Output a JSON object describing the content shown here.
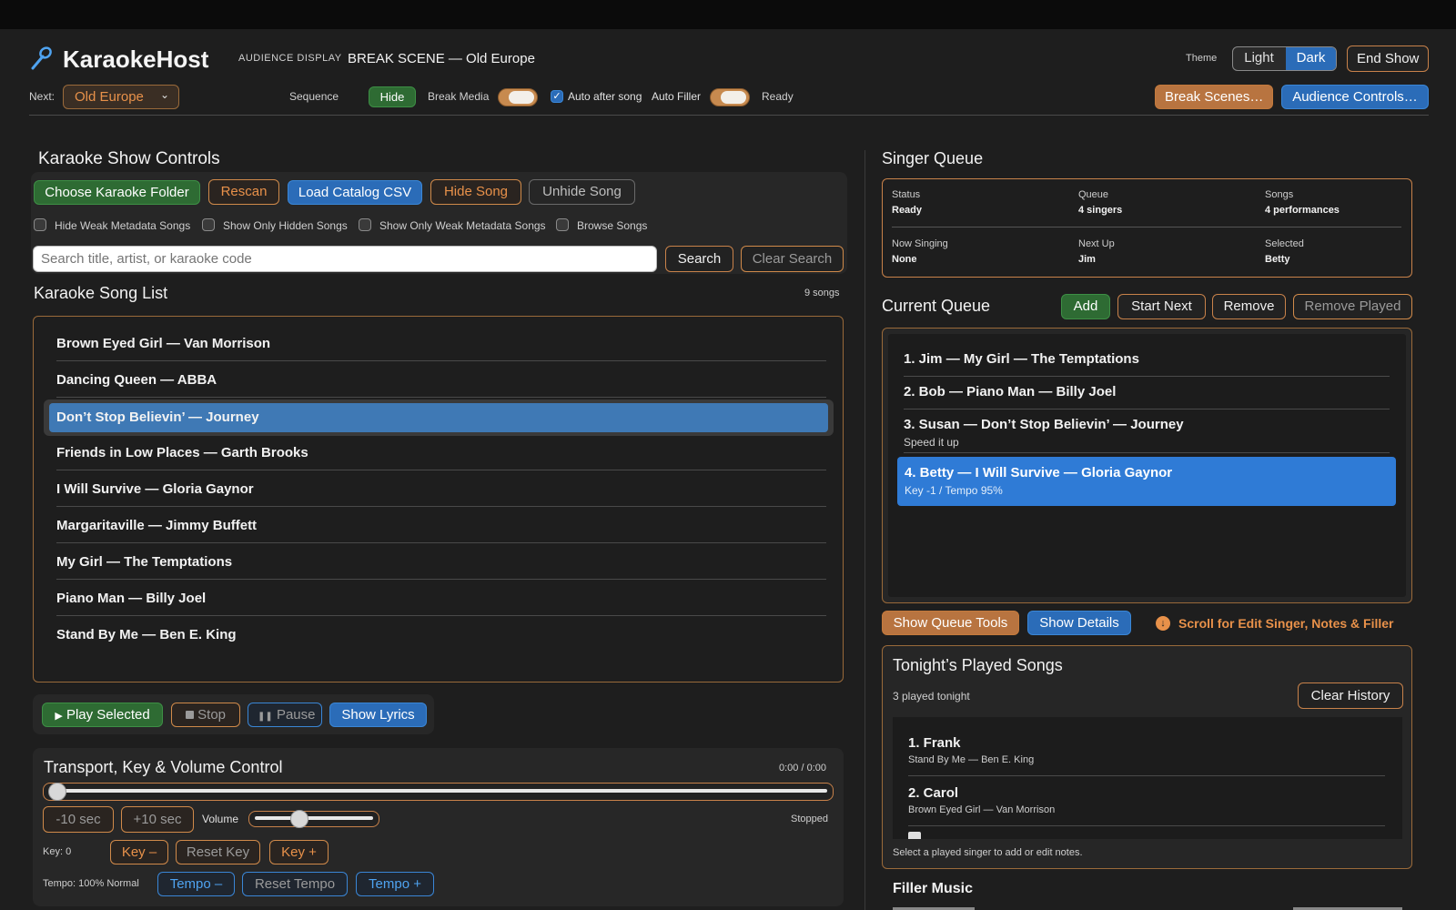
{
  "header": {
    "app_title": "KaraokeHost",
    "audience_display_label": "AUDIENCE DISPLAY",
    "audience_display_value": "BREAK SCENE — Old Europe",
    "theme_label": "Theme",
    "theme_light": "Light",
    "theme_dark": "Dark",
    "end_show": "End Show",
    "next_label": "Next:",
    "next_value": "Old Europe",
    "sequence_label": "Sequence",
    "hide_button": "Hide",
    "break_media_label": "Break Media",
    "auto_after_song_label": "Auto after song",
    "auto_after_song_checked": true,
    "auto_filler_label": "Auto Filler",
    "ready_label": "Ready",
    "break_scenes_button": "Break Scenes…",
    "audience_controls_button": "Audience Controls…"
  },
  "show_controls": {
    "title": "Karaoke Show Controls",
    "choose_folder": "Choose Karaoke Folder",
    "rescan": "Rescan",
    "load_catalog": "Load Catalog CSV",
    "hide_song": "Hide Song",
    "unhide_song": "Unhide Song",
    "filters": [
      "Hide Weak Metadata Songs",
      "Show Only Hidden Songs",
      "Show Only Weak Metadata Songs",
      "Browse Songs"
    ],
    "search_placeholder": "Search title, artist, or karaoke code",
    "search_button": "Search",
    "clear_search_button": "Clear Search"
  },
  "song_list": {
    "title": "Karaoke Song List",
    "count": "9 songs",
    "songs": [
      "Brown Eyed Girl — Van Morrison",
      "Dancing Queen — ABBA",
      "Don’t Stop Believin’ — Journey",
      "Friends in Low Places — Garth Brooks",
      "I Will Survive — Gloria Gaynor",
      "Margaritaville — Jimmy Buffett",
      "My Girl — The Temptations",
      "Piano Man — Billy Joel",
      "Stand By Me — Ben E. King"
    ],
    "selected_index": 2
  },
  "playback": {
    "play_selected": "Play Selected",
    "stop": "Stop",
    "pause": "Pause",
    "show_lyrics": "Show Lyrics"
  },
  "transport": {
    "title": "Transport, Key & Volume Control",
    "time": "0:00 / 0:00",
    "back_10": "-10 sec",
    "fwd_10": "+10 sec",
    "volume_label": "Volume",
    "status": "Stopped",
    "key_label": "Key: 0",
    "key_minus": "Key –",
    "reset_key": "Reset Key",
    "key_plus": "Key +",
    "tempo_label": "Tempo: 100% Normal",
    "tempo_minus": "Tempo –",
    "reset_tempo": "Reset Tempo",
    "tempo_plus": "Tempo +",
    "position_fraction": 0.0,
    "volume_fraction": 0.35
  },
  "singer_queue": {
    "title": "Singer Queue",
    "stats": [
      {
        "k": "Status",
        "v": "Ready"
      },
      {
        "k": "Queue",
        "v": "4 singers"
      },
      {
        "k": "Songs",
        "v": "4 performances"
      },
      {
        "k": "Now Singing",
        "v": "None"
      },
      {
        "k": "Next Up",
        "v": "Jim"
      },
      {
        "k": "Selected",
        "v": "Betty"
      }
    ]
  },
  "current_queue": {
    "title": "Current Queue",
    "add": "Add",
    "start_next": "Start Next",
    "remove": "Remove",
    "remove_played": "Remove Played",
    "items": [
      {
        "main": "1. Jim — My Girl — The Temptations",
        "sub": ""
      },
      {
        "main": "2. Bob — Piano Man — Billy Joel",
        "sub": ""
      },
      {
        "main": "3. Susan — Don’t Stop Believin’ — Journey",
        "sub": "Speed it up"
      },
      {
        "main": "4. Betty — I Will Survive — Gloria Gaynor",
        "sub": "Key -1 / Tempo 95%"
      }
    ],
    "selected_index": 3,
    "show_queue_tools": "Show Queue Tools",
    "show_details": "Show Details",
    "scroll_hint": "Scroll for Edit Singer, Notes & Filler"
  },
  "played_songs": {
    "title": "Tonight’s Played Songs",
    "count": "3 played tonight",
    "clear_history": "Clear History",
    "items": [
      {
        "name": "1. Frank",
        "song": "Stand By Me — Ben E. King"
      },
      {
        "name": "2. Carol",
        "song": "Brown Eyed Girl — Van Morrison"
      }
    ],
    "hint": "Select a played singer to add or edit notes."
  },
  "filler": {
    "title": "Filler Music"
  }
}
